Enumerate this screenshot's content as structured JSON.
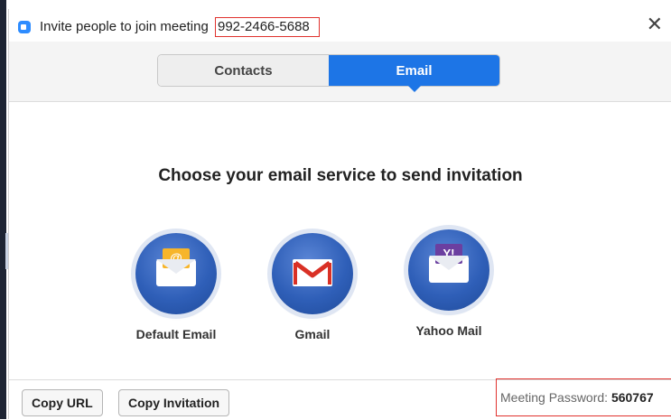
{
  "window": {
    "title": "Invite people to join meeting",
    "meeting_id": "992-2466-5688",
    "close_glyph": "✕"
  },
  "tabs": [
    {
      "label": "Contacts",
      "active": false
    },
    {
      "label": "Email",
      "active": true
    }
  ],
  "main": {
    "heading": "Choose your email service to send invitation",
    "services": [
      {
        "label": "Default Email",
        "icon": "default-email-icon"
      },
      {
        "label": "Gmail",
        "icon": "gmail-icon"
      },
      {
        "label": "Yahoo Mail",
        "icon": "yahoo-mail-icon"
      }
    ]
  },
  "footer": {
    "copy_url_label": "Copy URL",
    "copy_invitation_label": "Copy Invitation",
    "password_label": "Meeting Password:",
    "password_value": "560767"
  },
  "colors": {
    "accent_blue": "#1d75e6",
    "highlight_red": "#e0322e",
    "icon_circle": "#2f5fb8"
  }
}
